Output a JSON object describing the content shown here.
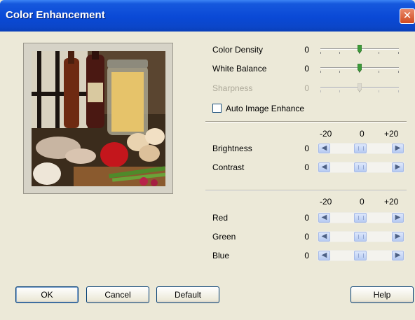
{
  "window": {
    "title": "Color Enhancement"
  },
  "sliders": {
    "color_density": {
      "label": "Color Density",
      "value": "0"
    },
    "white_balance": {
      "label": "White Balance",
      "value": "0"
    },
    "sharpness": {
      "label": "Sharpness",
      "value": "0"
    }
  },
  "auto_enhance": {
    "label": "Auto Image Enhance",
    "checked": false
  },
  "scale": {
    "min": "-20",
    "mid": "0",
    "max": "+20"
  },
  "scale2": {
    "min": "-20",
    "mid": "0",
    "max": "+20"
  },
  "bc": {
    "brightness": {
      "label": "Brightness",
      "value": "0"
    },
    "contrast": {
      "label": "Contrast",
      "value": "0"
    }
  },
  "rgb": {
    "red": {
      "label": "Red",
      "value": "0"
    },
    "green": {
      "label": "Green",
      "value": "0"
    },
    "blue": {
      "label": "Blue",
      "value": "0"
    }
  },
  "buttons": {
    "ok": "OK",
    "cancel": "Cancel",
    "default": "Default",
    "help": "Help"
  },
  "icons": {
    "left": "◀",
    "right": "▶",
    "close": "✕"
  },
  "colors": {
    "titlebar": "#0a49d6",
    "face": "#ece9d8",
    "thumb": "#3e9a3a"
  }
}
